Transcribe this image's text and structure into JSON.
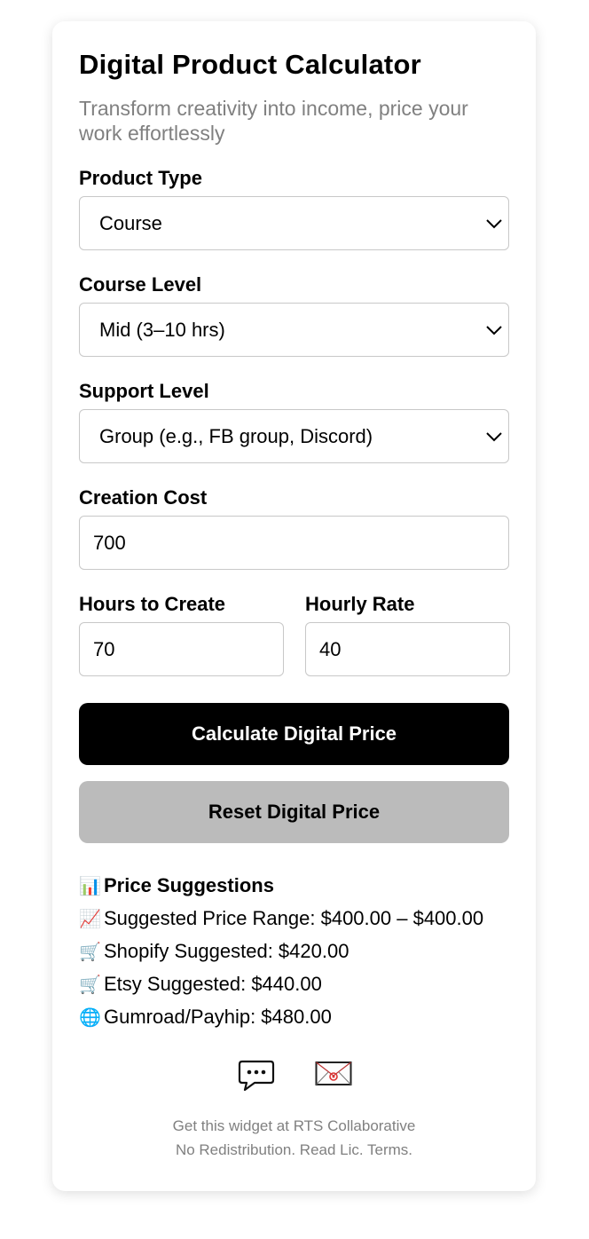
{
  "title": "Digital Product Calculator",
  "subtitle": "Transform creativity into income, price your work effortlessly",
  "product_type": {
    "label": "Product Type",
    "value": "Course"
  },
  "course_level": {
    "label": "Course Level",
    "value": "Mid (3–10 hrs)"
  },
  "support_level": {
    "label": "Support Level",
    "value": "Group (e.g., FB group, Discord)"
  },
  "creation_cost": {
    "label": "Creation Cost",
    "value": "700"
  },
  "hours": {
    "label": "Hours to Create",
    "value": "70"
  },
  "rate": {
    "label": "Hourly Rate",
    "value": "40"
  },
  "buttons": {
    "calculate": "Calculate Digital Price",
    "reset": "Reset Digital Price"
  },
  "results": {
    "heading": "Price Suggestions",
    "range": "Suggested Price Range: $400.00 – $400.00",
    "shopify": "Shopify Suggested: $420.00",
    "etsy": "Etsy Suggested: $440.00",
    "gumroad": "Gumroad/Payhip: $480.00"
  },
  "icons": {
    "heading": "bar-chart-icon",
    "range": "chart-increasing-icon",
    "shopify": "shopping-cart-icon",
    "etsy": "shopping-cart-icon",
    "gumroad": "globe-icon",
    "chat": "chat-bubble-icon",
    "email": "email-icon"
  },
  "footer": {
    "line1": "Get this widget at RTS Collaborative",
    "line2": "No Redistribution. Read Lic. Terms."
  }
}
